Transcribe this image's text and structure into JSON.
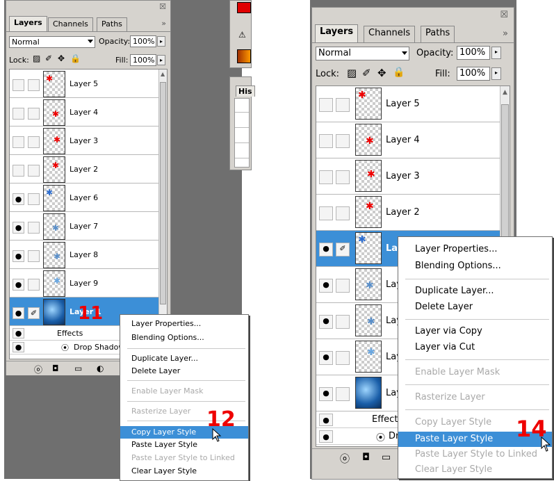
{
  "left_panel": {
    "tabs": [
      "Layers",
      "Channels",
      "Paths"
    ],
    "blend_mode": "Normal",
    "opacity_label": "Opacity:",
    "opacity_value": "100%",
    "lock_label": "Lock:",
    "fill_label": "Fill:",
    "fill_value": "100%",
    "layers": [
      "Layer 5",
      "Layer 4",
      "Layer 3",
      "Layer 2",
      "Layer 6",
      "Layer 7",
      "Layer 8",
      "Layer 9"
    ],
    "selected_layer": "Layer 1",
    "effects_label": "Effects",
    "drop_shadow_label": "Drop Shadow",
    "step_label": "11"
  },
  "left_menu": {
    "items": [
      "Layer Properties...",
      "Blending Options...",
      "Duplicate Layer...",
      "Delete Layer",
      "Enable Layer Mask",
      "Rasterize Layer",
      "Copy Layer Style",
      "Paste Layer Style",
      "Paste Layer Style to Linked",
      "Clear Layer Style"
    ],
    "step_label": "12"
  },
  "history_panel": {
    "title": "His"
  },
  "right_panel": {
    "tabs": [
      "Layers",
      "Channels",
      "Paths"
    ],
    "blend_mode": "Normal",
    "opacity_label": "Opacity:",
    "opacity_value": "100%",
    "lock_label": "Lock:",
    "fill_label": "Fill:",
    "fill_value": "100%",
    "layers": [
      "Layer 5",
      "Layer 4",
      "Layer 3",
      "Layer 2"
    ],
    "selected_layer_prefix": "La",
    "partial_layer_prefix": "Lay",
    "effects_label": "Effects",
    "drop_shadow_prefix": "Dr"
  },
  "right_menu": {
    "items": [
      "Layer Properties...",
      "Blending Options...",
      "Duplicate Layer...",
      "Delete Layer",
      "Layer via Copy",
      "Layer via Cut",
      "Enable Layer Mask",
      "Rasterize Layer",
      "Copy Layer Style",
      "Paste Layer Style",
      "Paste Layer Style to Linked",
      "Clear Layer Style"
    ],
    "step_label": "14"
  },
  "colors": {
    "highlight": "#3c8fd7",
    "step_number": "#ee0000",
    "canvas_gray": "#6f6f6f"
  },
  "icons": [
    "eye-icon",
    "brush-icon",
    "lock-transparent-icon",
    "move-icon",
    "lock-icon",
    "close-icon",
    "menu-arrow-icon",
    "effects-icon",
    "add-mask-icon",
    "new-layer-icon",
    "cursor-icon"
  ]
}
